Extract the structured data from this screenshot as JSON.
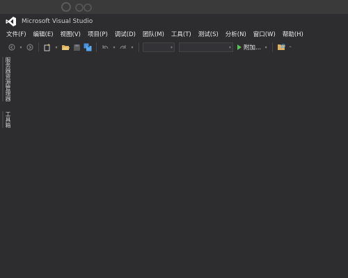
{
  "window": {
    "title": "Microsoft Visual Studio"
  },
  "menu": [
    {
      "label": "文件(F)",
      "name": "menu-file"
    },
    {
      "label": "编辑(E)",
      "name": "menu-edit"
    },
    {
      "label": "视图(V)",
      "name": "menu-view"
    },
    {
      "label": "项目(P)",
      "name": "menu-project"
    },
    {
      "label": "调试(D)",
      "name": "menu-debug"
    },
    {
      "label": "团队(M)",
      "name": "menu-team"
    },
    {
      "label": "工具(T)",
      "name": "menu-tools"
    },
    {
      "label": "测试(S)",
      "name": "menu-test"
    },
    {
      "label": "分析(N)",
      "name": "menu-analyze"
    },
    {
      "label": "窗口(W)",
      "name": "menu-window"
    },
    {
      "label": "帮助(H)",
      "name": "menu-help"
    }
  ],
  "toolbar": {
    "attach_label": "附加...",
    "config_value": "",
    "platform_value": ""
  },
  "sidebar": {
    "tabs": [
      {
        "label": "服务器资源管理器",
        "name": "side-tab-server-explorer"
      },
      {
        "label": "工具箱",
        "name": "side-tab-toolbox"
      }
    ]
  },
  "colors": {
    "background": "#2d2d30",
    "accent_purple": "#68217a",
    "play_green": "#5ac35a"
  }
}
